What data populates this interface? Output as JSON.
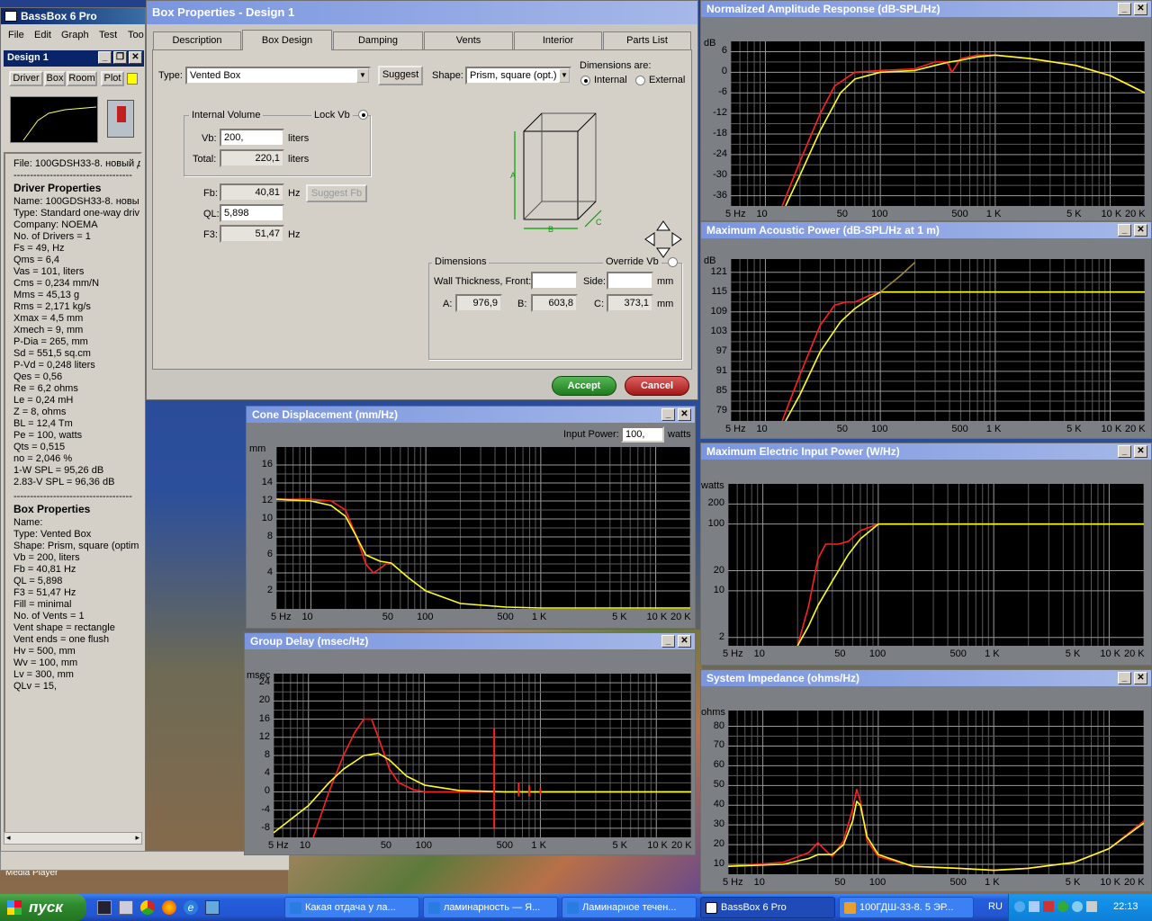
{
  "app": {
    "title": "BassBox 6 Pro",
    "menu": [
      "File",
      "Edit",
      "Graph",
      "Test",
      "Too"
    ]
  },
  "design_panel": {
    "title": "Design 1",
    "buttons": [
      "Driver",
      "Box",
      "Room",
      "Plot"
    ],
    "file_line": "File: 100GDSH33-8. новый даташ",
    "driver_header": "Driver Properties",
    "driver_lines": [
      "Name: 100GDSH33-8. новы",
      "Type: Standard one-way driv",
      "Company: NOEMA",
      "No. of Drivers = 1",
      "Fs = 49, Hz",
      "Qms = 6,4",
      "Vas = 101, liters",
      "Cms = 0,234 mm/N",
      "Mms = 45,13 g",
      "Rms = 2,171 kg/s",
      "Xmax = 4,5 mm",
      "Xmech = 9, mm",
      "P-Dia = 265, mm",
      "Sd = 551,5 sq.cm",
      "P-Vd = 0,248 liters",
      "Qes = 0,56",
      "Re = 6,2 ohms",
      "Le = 0,24 mH",
      "Z = 8, ohms",
      "BL = 12,4 Tm",
      "Pe = 100, watts",
      "Qts = 0,515",
      "no = 2,046 %",
      "1-W SPL = 95,26 dB",
      "2.83-V SPL = 96,36 dB"
    ],
    "box_header": "Box Properties",
    "box_lines": [
      "Name:",
      "Type: Vented Box",
      "Shape: Prism, square (optim",
      "Vb = 200, liters",
      "Fb = 40,81 Hz",
      "QL = 5,898",
      "F3 = 51,47 Hz",
      "Fill = minimal",
      "No. of Vents = 1",
      " Vent shape = rectangle",
      " Vent ends = one flush",
      " Hv = 500, mm",
      " Wv = 100, mm",
      " Lv = 300, mm",
      " QLv = 15,"
    ]
  },
  "dialog": {
    "title": "Box Properties - Design 1",
    "tabs": [
      "Description",
      "Box Design",
      "Damping",
      "Vents",
      "Interior",
      "Parts List"
    ],
    "type_label": "Type:",
    "type_value": "Vented Box",
    "suggest": "Suggest",
    "shape_label": "Shape:",
    "shape_value": "Prism, square (opt.)",
    "dims_are": "Dimensions are:",
    "internal": "Internal",
    "external": "External",
    "internal_volume": "Internal Volume",
    "lock_vb": "Lock Vb",
    "vb_label": "Vb:",
    "vb_value": "200,",
    "total_label": "Total:",
    "total_value": "220,1",
    "liters": "liters",
    "fb_label": "Fb:",
    "fb_value": "40,81",
    "hz": "Hz",
    "suggest_fb": "Suggest Fb",
    "ql_label": "QL:",
    "ql_value": "5,898",
    "f3_label": "F3:",
    "f3_value": "51,47",
    "dimensions": "Dimensions",
    "override_vb": "Override Vb",
    "wall_front": "Wall Thickness, Front:",
    "side": "Side:",
    "mm": "mm",
    "a_label": "A:",
    "a_value": "976,9",
    "b_label": "B:",
    "b_value": "603,8",
    "c_label": "C:",
    "c_value": "373,1",
    "accept": "Accept",
    "cancel": "Cancel",
    "box_letters": [
      "A",
      "B",
      "C"
    ]
  },
  "charts": {
    "amp": {
      "title": "Normalized Amplitude Response (dB-SPL/Hz)",
      "unit": "dB",
      "yticks": [
        "6",
        "0",
        "-6",
        "-12",
        "-18",
        "-24",
        "-30",
        "-36"
      ],
      "xticks": [
        "5 Hz",
        "10",
        "50",
        "100",
        "500",
        "1 K",
        "5 K",
        "10 K",
        "20 K"
      ]
    },
    "pow": {
      "title": "Maximum Acoustic Power (dB-SPL/Hz at 1 m)",
      "unit": "dB",
      "yticks": [
        "121",
        "115",
        "109",
        "103",
        "97",
        "91",
        "85",
        "79"
      ],
      "xticks": [
        "5 Hz",
        "10",
        "50",
        "100",
        "500",
        "1 K",
        "5 K",
        "10 K",
        "20 K"
      ]
    },
    "elec": {
      "title": "Maximum Electric Input Power (W/Hz)",
      "unit": "watts",
      "yticks": [
        "200",
        "100",
        "20",
        "10",
        "2"
      ],
      "xticks": [
        "5 Hz",
        "10",
        "50",
        "100",
        "500",
        "1 K",
        "5 K",
        "10 K",
        "20 K"
      ]
    },
    "imp": {
      "title": "System Impedance (ohms/Hz)",
      "unit": "ohms",
      "yticks": [
        "80",
        "70",
        "60",
        "50",
        "40",
        "30",
        "20",
        "10"
      ],
      "xticks": [
        "5 Hz",
        "10",
        "50",
        "100",
        "500",
        "1 K",
        "5 K",
        "10 K",
        "20 K"
      ]
    },
    "cone": {
      "title": "Cone Displacement (mm/Hz)",
      "unit": "mm",
      "input_power_label": "Input Power:",
      "input_power_value": "100,",
      "watts": "watts",
      "yticks": [
        "16",
        "14",
        "12",
        "10",
        "8",
        "6",
        "4",
        "2"
      ],
      "xticks": [
        "5 Hz",
        "10",
        "50",
        "100",
        "500",
        "1 K",
        "5 K",
        "10 K",
        "20 K"
      ]
    },
    "gd": {
      "title": "Group Delay (msec/Hz)",
      "unit": "msec",
      "yticks": [
        "24",
        "20",
        "16",
        "12",
        "8",
        "4",
        "0",
        "-4",
        "-8"
      ],
      "xticks": [
        "5 Hz",
        "10",
        "50",
        "100",
        "500",
        "1 K",
        "5 K",
        "10 K",
        "20 K"
      ]
    }
  },
  "chart_data": [
    {
      "type": "line",
      "title": "Normalized Amplitude Response (dB-SPL/Hz)",
      "ylabel": "dB",
      "x_scale": "log",
      "xlim": [
        5,
        20000
      ],
      "ylim": [
        -39,
        9
      ],
      "series": [
        {
          "color": "#ff2020",
          "x": [
            14,
            20,
            30,
            40,
            60,
            100,
            200,
            300,
            380,
            420,
            500,
            700,
            1000,
            2000,
            5000,
            10000,
            20000
          ],
          "y": [
            -39,
            -26,
            -12,
            -4,
            0,
            0.5,
            1,
            3,
            3,
            0,
            4,
            5,
            5,
            4,
            2,
            -1,
            -6
          ]
        },
        {
          "color": "#ffff20",
          "x": [
            15,
            20,
            30,
            45,
            60,
            100,
            200,
            300,
            400,
            500,
            700,
            1000,
            2000,
            5000,
            10000,
            20000
          ],
          "y": [
            -39,
            -30,
            -17,
            -6,
            -2,
            0,
            0.5,
            2,
            3,
            3.5,
            4.5,
            5,
            4,
            2,
            -1,
            -6
          ]
        }
      ]
    },
    {
      "type": "line",
      "title": "Maximum Acoustic Power (dB-SPL/Hz at 1 m)",
      "ylabel": "dB",
      "x_scale": "log",
      "xlim": [
        5,
        20000
      ],
      "ylim": [
        76,
        125
      ],
      "series": [
        {
          "color": "#ff2020",
          "x": [
            14,
            20,
            30,
            40,
            50,
            60,
            70,
            80,
            100,
            20000
          ],
          "y": [
            76,
            90,
            105,
            111,
            112,
            112,
            113,
            114,
            115,
            115
          ]
        },
        {
          "color": "#ffff20",
          "x": [
            15,
            20,
            30,
            45,
            60,
            80,
            100,
            20000
          ],
          "y": [
            76,
            84,
            97,
            106,
            110,
            113,
            115,
            115
          ]
        },
        {
          "color": "#9a8a30",
          "x": [
            100,
            150,
            200
          ],
          "y": [
            115,
            120,
            124
          ]
        }
      ]
    },
    {
      "type": "line",
      "title": "Maximum Electric Input Power (W/Hz)",
      "ylabel": "watts",
      "x_scale": "log",
      "y_scale": "log",
      "xlim": [
        5,
        20000
      ],
      "ylim": [
        1.5,
        400
      ],
      "series": [
        {
          "color": "#ff2020",
          "x": [
            20,
            25,
            30,
            35,
            45,
            55,
            70,
            100,
            20000
          ],
          "y": [
            1.5,
            6,
            30,
            50,
            50,
            55,
            80,
            100,
            100
          ]
        },
        {
          "color": "#ffff20",
          "x": [
            20,
            25,
            30,
            40,
            55,
            70,
            100,
            20000
          ],
          "y": [
            1.5,
            3,
            6,
            14,
            35,
            60,
            100,
            100
          ]
        }
      ]
    },
    {
      "type": "line",
      "title": "System Impedance (ohms/Hz)",
      "ylabel": "ohms",
      "x_scale": "log",
      "xlim": [
        5,
        20000
      ],
      "ylim": [
        5,
        88
      ],
      "series": [
        {
          "color": "#ff2020",
          "x": [
            5,
            15,
            25,
            30,
            35,
            40,
            50,
            60,
            65,
            70,
            80,
            100,
            200,
            500,
            1000,
            2000,
            5000,
            10000,
            20000
          ],
          "y": [
            9,
            11,
            16,
            21,
            17,
            14,
            22,
            38,
            48,
            42,
            22,
            14,
            9,
            8,
            7,
            8,
            11,
            18,
            32
          ]
        },
        {
          "color": "#ffff20",
          "x": [
            5,
            15,
            25,
            30,
            40,
            50,
            60,
            65,
            70,
            80,
            100,
            200,
            500,
            1000,
            2000,
            5000,
            10000,
            20000
          ],
          "y": [
            9,
            10,
            13,
            15,
            15,
            20,
            32,
            42,
            40,
            24,
            15,
            9,
            8,
            7,
            8,
            11,
            18,
            31
          ]
        }
      ]
    },
    {
      "type": "line",
      "title": "Cone Displacement (mm/Hz)",
      "ylabel": "mm",
      "x_scale": "log",
      "xlim": [
        5,
        20000
      ],
      "ylim": [
        0,
        18
      ],
      "series": [
        {
          "color": "#ff2020",
          "x": [
            5,
            10,
            15,
            20,
            25,
            30,
            35,
            40,
            45,
            50
          ],
          "y": [
            12.2,
            12.2,
            12,
            11,
            8,
            5,
            4,
            4.5,
            5,
            5
          ]
        },
        {
          "color": "#ffff20",
          "x": [
            5,
            10,
            15,
            20,
            25,
            30,
            40,
            50,
            70,
            100,
            200,
            500,
            1000,
            20000
          ],
          "y": [
            12.2,
            12,
            11.5,
            10.3,
            8,
            6,
            5.3,
            5.1,
            3.5,
            2,
            0.6,
            0.2,
            0.1,
            0.1
          ]
        }
      ]
    },
    {
      "type": "line",
      "title": "Group Delay (msec/Hz)",
      "ylabel": "msec",
      "x_scale": "log",
      "xlim": [
        5,
        20000
      ],
      "ylim": [
        -10,
        26
      ],
      "series": [
        {
          "color": "#ff2020",
          "x": [
            11,
            15,
            20,
            25,
            30,
            35,
            40,
            50,
            60,
            80,
            100,
            200,
            380,
            400,
            500,
            1000,
            20000
          ],
          "y": [
            -10,
            0,
            8,
            13,
            16,
            16,
            12,
            5,
            2,
            0.5,
            0,
            0,
            0,
            0,
            0,
            0,
            0
          ]
        },
        {
          "color": "#ffff20",
          "x": [
            5,
            10,
            15,
            20,
            30,
            40,
            50,
            70,
            100,
            200,
            500,
            1000,
            20000
          ],
          "y": [
            -9,
            -3,
            2,
            5,
            8,
            8.5,
            7,
            3.5,
            1.5,
            0.3,
            0,
            0,
            0
          ]
        }
      ]
    }
  ],
  "taskbar": {
    "start": "пуск",
    "items": [
      "Какая отдача у ла...",
      "ламинарность — Я...",
      "Ламинарное течен...",
      "BassBox 6 Pro",
      "100ГДШ-33-8. 5 ЭР..."
    ],
    "lang": "RU",
    "clock": "22:13"
  },
  "desktop": {
    "media_player": "Media Player"
  },
  "colors": {
    "red": "#ff2020",
    "yellow": "#ffff20",
    "title_active": "#0a246a",
    "title_inactive": "#7a96df"
  }
}
